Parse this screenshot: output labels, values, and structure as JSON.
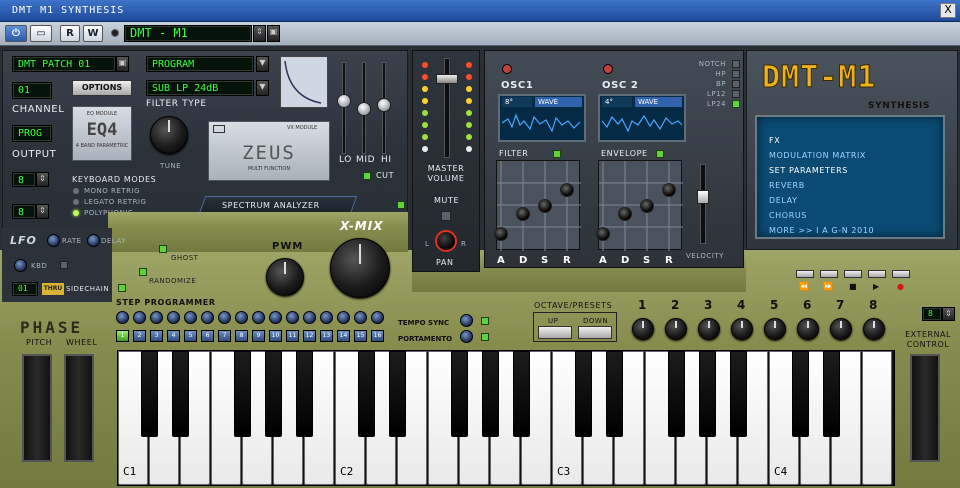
{
  "window": {
    "title": "DMT M1 SYNTHESIS",
    "close_glyph": "X"
  },
  "toolbar": {
    "power_glyph": "⏻",
    "minimize_glyph": "▭",
    "r_label": "R",
    "w_label": "W",
    "patch_name": "DMT - M1"
  },
  "left": {
    "patch_display": "DMT PATCH 01",
    "program_display": "PROGRAM",
    "filter_display": "SUB LP 24dB",
    "filter_type_label": "FILTER TYPE",
    "channel_display": "01",
    "options_label": "OPTIONS",
    "channel_label": "CHANNEL",
    "prog_display": "PROG",
    "output_label": "OUTPUT",
    "eq_module": {
      "small": "EQ MODULE",
      "big": "EQ4",
      "sub": "4 BAND PARAMETRIC"
    },
    "tune_label": "TUNE",
    "vx_module": "VX MODULE",
    "zeus": {
      "big": "ZEUS",
      "sub": "MULTI FUNCTION"
    },
    "eq_sliders": [
      "LO",
      "MID",
      "HI"
    ],
    "cut_label": "CUT",
    "keyboard_modes_label": "KEYBOARD MODES",
    "keyboard_modes": [
      "MONO RETRIG",
      "LEGATO RETRIG",
      "POLYPHONIC"
    ],
    "kb_mode_value_1": "8",
    "kb_mode_value_2": "8",
    "spectrum_label": "SPECTRUM ANALYZER",
    "lfo_label": "LFO",
    "rate_label": "RATE",
    "delay_label": "DELAY",
    "kbd_label": "KBD",
    "ch_display": "01",
    "thru_label": "THRU",
    "sidechain_label": "SIDECHAIN"
  },
  "middle": {
    "ghost_label": "GHOST",
    "randomize_label": "RANDOMIZE",
    "pwm_label": "PWM",
    "xmix_label": "X-MIX",
    "master_volume_label": "MASTER VOLUME",
    "mute_label": "MUTE",
    "pan_label": "PAN",
    "pan_l": "L",
    "pan_r": "R"
  },
  "osc": {
    "osc1_label": "OSC1",
    "osc2_label": "OSC 2",
    "osc1_value": "8°",
    "osc2_value": "4°",
    "wave_label": "WAVE",
    "filter_label": "FILTER",
    "envelope_label": "ENVELOPE",
    "filter_modes": [
      "NOTCH",
      "HP",
      "BP",
      "LP12",
      "LP24"
    ],
    "adsr": [
      "A",
      "D",
      "S",
      "R"
    ],
    "velocity_label": "VELOCITY"
  },
  "right": {
    "logo": "DMT-M1",
    "logo_sub": "SYNTHESIS",
    "fx_items": [
      {
        "label": "FX",
        "color": "#ffffff"
      },
      {
        "label": "MODULATION MATRIX",
        "color": "#9fd4ff"
      },
      {
        "label": "SET PARAMETERS",
        "color": "#ffffff"
      },
      {
        "label": "REVERB",
        "color": "#9fd4ff"
      },
      {
        "label": "DELAY",
        "color": "#9fd4ff"
      },
      {
        "label": "CHORUS",
        "color": "#9fd4ff"
      },
      {
        "label": "MORE >> I A G-N 2010",
        "color": "#9fd4ff"
      }
    ],
    "transport": [
      "⏪",
      "⏩",
      "■",
      "▶",
      "●"
    ]
  },
  "step": {
    "label": "STEP PROGRAMMER",
    "steps": [
      "1",
      "2",
      "3",
      "4",
      "5",
      "6",
      "7",
      "8",
      "9",
      "10",
      "11",
      "12",
      "13",
      "14",
      "15",
      "16"
    ],
    "tempo_sync_label": "TEMPO SYNC",
    "portamento_label": "PORTAMENTO"
  },
  "octave": {
    "label": "OCTAVE/PRESETS",
    "up_label": "UP",
    "down_label": "DOWN"
  },
  "presets": {
    "numbers": [
      "1",
      "2",
      "3",
      "4",
      "5",
      "6",
      "7",
      "8"
    ]
  },
  "external": {
    "value": "8",
    "label": "EXTERNAL CONTROL"
  },
  "phase": {
    "logo": "PHASE",
    "pitch_label": "PITCH",
    "wheel_label": "WHEEL"
  },
  "keyboard": {
    "octave_labels": [
      "C1",
      "C2",
      "C3",
      "C4"
    ]
  },
  "colors": {
    "accent_green": "#5fd13a",
    "lcd_green": "#3cff3c",
    "olive": "#858c4d",
    "fx_blue": "#0b4b73"
  }
}
